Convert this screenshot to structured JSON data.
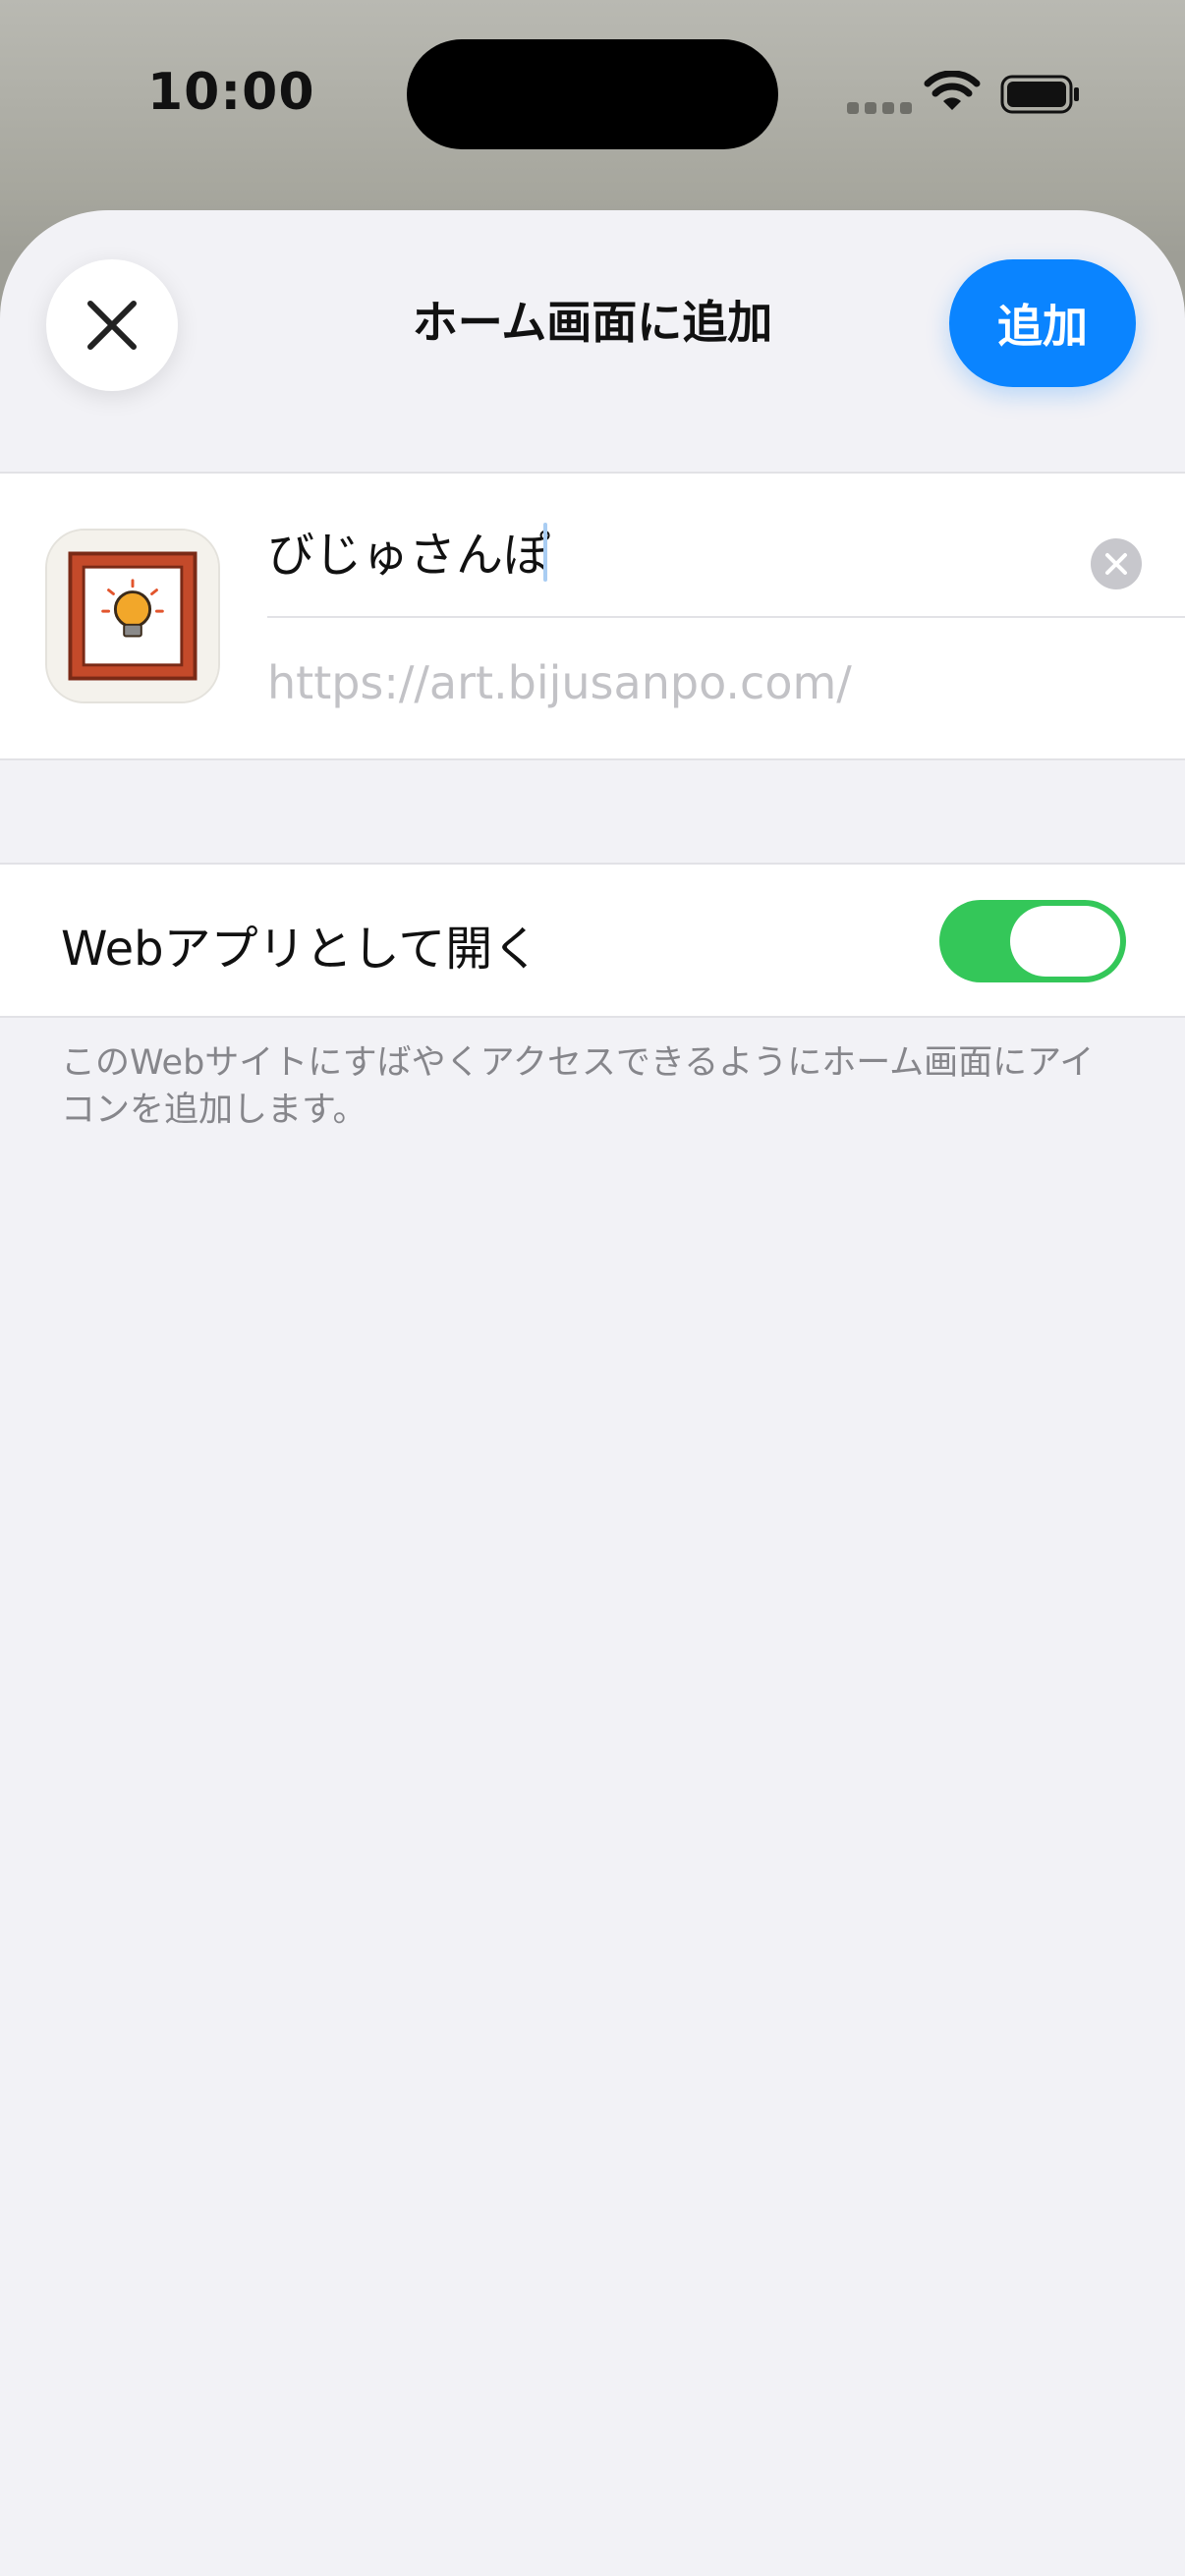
{
  "status_bar": {
    "time": "10:00",
    "wifi_icon": "wifi-icon",
    "battery_icon": "battery-icon"
  },
  "header": {
    "title": "ホーム画面に追加",
    "close_icon": "close-icon",
    "add_label": "追加"
  },
  "form": {
    "name_value": "びじゅさんぽ",
    "clear_icon": "clear-icon",
    "url": "https://art.bijusanpo.com/",
    "app_icon": "framed-lightbulb-icon"
  },
  "web_app": {
    "label": "Webアプリとして開く",
    "enabled": true,
    "on_color": "#34c759"
  },
  "footer": {
    "note": "このWebサイトにすばやくアクセスできるようにホーム画面にアイコンを追加します。"
  },
  "colors": {
    "accent": "#0a84ff",
    "background": "#f2f2f6"
  }
}
